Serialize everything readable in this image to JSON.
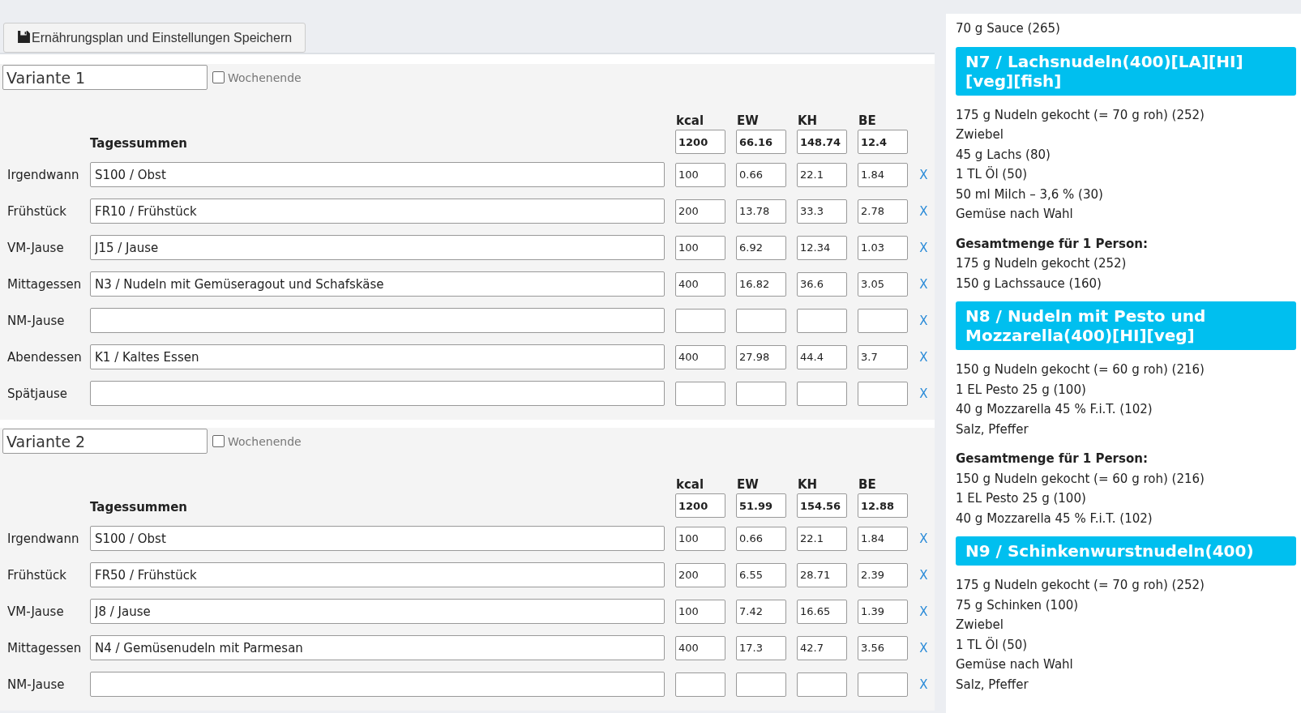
{
  "save_button": {
    "label": "Ernährungsplan und Einstellungen Speichern"
  },
  "variants": [
    {
      "name": "Variante 1",
      "weekend": {
        "label": "Wochenende",
        "checked": false
      },
      "columns": [
        "kcal",
        "EW",
        "KH",
        "BE"
      ],
      "totals": {
        "label": "Tagessummen",
        "values": [
          "1200",
          "66.16",
          "148.74",
          "12.4"
        ]
      },
      "meals": [
        {
          "label": "Irgendwann",
          "value": "S100 / Obst",
          "values": [
            "100",
            "0.66",
            "22.1",
            "1.84"
          ],
          "remove": "X"
        },
        {
          "label": "Frühstück",
          "value": "FR10 / Frühstück",
          "values": [
            "200",
            "13.78",
            "33.3",
            "2.78"
          ],
          "remove": "X"
        },
        {
          "label": "VM-Jause",
          "value": "J15 / Jause",
          "values": [
            "100",
            "6.92",
            "12.34",
            "1.03"
          ],
          "remove": "X"
        },
        {
          "label": "Mittagessen",
          "value": "N3 / Nudeln mit Gemüseragout und Schafskäse",
          "values": [
            "400",
            "16.82",
            "36.6",
            "3.05"
          ],
          "remove": "X"
        },
        {
          "label": "NM-Jause",
          "remove": "X"
        },
        {
          "label": "Abendessen",
          "value": "K1 / Kaltes Essen",
          "values": [
            "400",
            "27.98",
            "44.4",
            "3.7"
          ],
          "remove": "X"
        },
        {
          "label": "Spätjause",
          "remove": "X"
        }
      ]
    },
    {
      "name": "Variante 2",
      "weekend": {
        "label": "Wochenende",
        "checked": false
      },
      "columns": [
        "kcal",
        "EW",
        "KH",
        "BE"
      ],
      "totals": {
        "label": "Tagessummen",
        "values": [
          "1200",
          "51.99",
          "154.56",
          "12.88"
        ]
      },
      "meals": [
        {
          "label": "Irgendwann",
          "value": "S100 / Obst",
          "values": [
            "100",
            "0.66",
            "22.1",
            "1.84"
          ],
          "remove": "X"
        },
        {
          "label": "Frühstück",
          "value": "FR50 / Frühstück",
          "values": [
            "200",
            "6.55",
            "28.71",
            "2.39"
          ],
          "remove": "X"
        },
        {
          "label": "VM-Jause",
          "value": "J8 / Jause",
          "values": [
            "100",
            "7.42",
            "16.65",
            "1.39"
          ],
          "remove": "X"
        },
        {
          "label": "Mittagessen",
          "value": "N4 / Gemüsenudeln mit Parmesan",
          "values": [
            "400",
            "17.3",
            "42.7",
            "3.56"
          ],
          "remove": "X"
        },
        {
          "label": "NM-Jause",
          "remove": "X"
        }
      ]
    }
  ],
  "recipe_panel": [
    {
      "kind": "line",
      "text": "70 g Sauce (265)"
    },
    {
      "kind": "heading",
      "text": "N7 / Lachsnudeln(400)[LA][HI] [veg][fish]"
    },
    {
      "kind": "line",
      "text": "175 g Nudeln gekocht (= 70 g roh) (252)"
    },
    {
      "kind": "line",
      "text": "Zwiebel"
    },
    {
      "kind": "line",
      "text": "45 g Lachs (80)"
    },
    {
      "kind": "line",
      "text": "1 TL Öl (50)"
    },
    {
      "kind": "line",
      "text": "50 ml Milch – 3,6 % (30)"
    },
    {
      "kind": "line",
      "text": "Gemüse nach Wahl"
    },
    {
      "kind": "subheading",
      "text": "Gesamtmenge für 1 Person:"
    },
    {
      "kind": "line",
      "text": "175 g Nudeln gekocht (252)"
    },
    {
      "kind": "line",
      "text": "150 g Lachssauce (160)"
    },
    {
      "kind": "heading",
      "text": "N8 / Nudeln mit Pesto und Mozzarella(400)[HI][veg]"
    },
    {
      "kind": "line",
      "text": "150 g Nudeln gekocht (= 60 g roh) (216)"
    },
    {
      "kind": "line",
      "text": "1 EL Pesto 25 g (100)"
    },
    {
      "kind": "line",
      "text": "40 g Mozzarella 45 % F.i.T. (102)"
    },
    {
      "kind": "line",
      "text": "Salz, Pfeffer"
    },
    {
      "kind": "subheading",
      "text": "Gesamtmenge für 1 Person:"
    },
    {
      "kind": "line",
      "text": "150 g Nudeln gekocht (= 60 g roh) (216)"
    },
    {
      "kind": "line",
      "text": "1 EL Pesto 25 g (100)"
    },
    {
      "kind": "line",
      "text": "40 g Mozzarella 45 % F.i.T. (102)"
    },
    {
      "kind": "heading",
      "text": "N9 / Schinkenwurstnudeln(400)"
    },
    {
      "kind": "line",
      "text": "175 g Nudeln gekocht (= 70 g roh) (252)"
    },
    {
      "kind": "line",
      "text": "75 g Schinken (100)"
    },
    {
      "kind": "line",
      "text": "Zwiebel"
    },
    {
      "kind": "line",
      "text": "1 TL Öl (50)"
    },
    {
      "kind": "line",
      "text": "Gemüse nach Wahl"
    },
    {
      "kind": "line",
      "text": "Salz, Pfeffer"
    }
  ]
}
